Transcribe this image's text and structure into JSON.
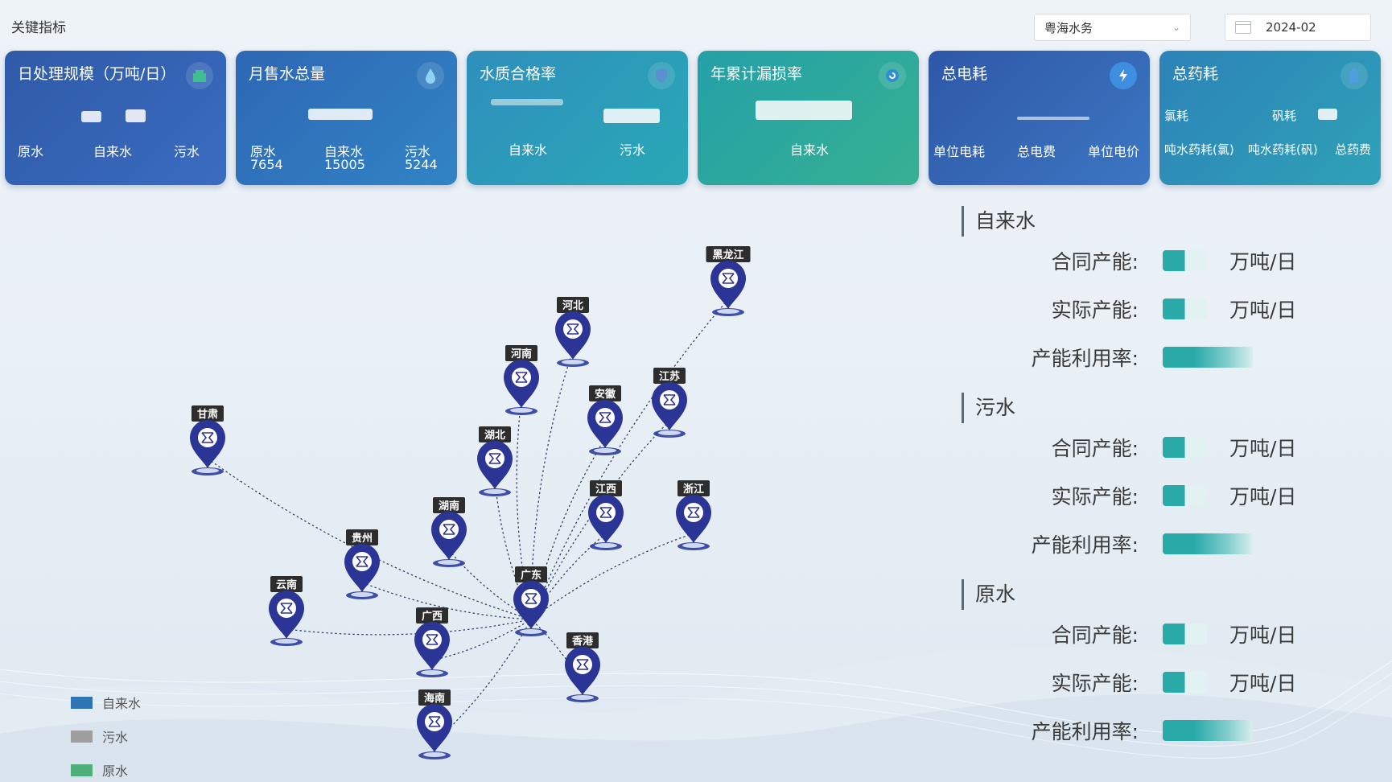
{
  "header": {
    "title": "关键指标",
    "org_select": "粤海水务",
    "date": "2024-02"
  },
  "cards": {
    "daily_scale": {
      "title": "日处理规模（万吨/日）",
      "icon": "building-icon",
      "labels": [
        "原水",
        "自来水",
        "污水"
      ]
    },
    "monthly_sales": {
      "title": "月售水总量",
      "icon": "water-drop-icon",
      "labels": [
        "原水",
        "自来水",
        "污水"
      ],
      "values": [
        "7654",
        "15005",
        "5244"
      ]
    },
    "water_quality": {
      "title": "水质合格率",
      "icon": "shield-icon",
      "labels": [
        "自来水",
        "污水"
      ]
    },
    "leak_rate": {
      "title": "年累计漏损率",
      "icon": "refresh-icon",
      "labels": [
        "自来水"
      ]
    },
    "power": {
      "title": "总电耗",
      "icon": "lightning-drop-icon",
      "labels": [
        "单位电耗",
        "总电费",
        "单位电价"
      ]
    },
    "chemicals": {
      "title": "总药耗",
      "icon": "bottle-icon",
      "top_labels": [
        "氯耗",
        "矾耗"
      ],
      "labels": [
        "吨水药耗(氯)",
        "吨水药耗(矾)",
        "总药费"
      ]
    }
  },
  "map": {
    "provinces": [
      "黑龙江",
      "河北",
      "河南",
      "江苏",
      "安徽",
      "甘肃",
      "湖北",
      "江西",
      "浙江",
      "湖南",
      "贵州",
      "广东",
      "云南",
      "广西",
      "香港",
      "海南"
    ],
    "hub": "广东"
  },
  "legend": [
    {
      "label": "自来水",
      "color": "#2f74b5"
    },
    {
      "label": "污水",
      "color": "#9e9e9e"
    },
    {
      "label": "原水",
      "color": "#4fae7a"
    }
  ],
  "right_panel": {
    "sections": [
      {
        "title": "自来水",
        "rows": [
          {
            "label": "合同产能:",
            "unit": "万吨/日"
          },
          {
            "label": "实际产能:",
            "unit": "万吨/日"
          },
          {
            "label": "产能利用率:",
            "unit": ""
          }
        ]
      },
      {
        "title": "污水",
        "rows": [
          {
            "label": "合同产能:",
            "unit": "万吨/日"
          },
          {
            "label": "实际产能:",
            "unit": "万吨/日"
          },
          {
            "label": "产能利用率:",
            "unit": ""
          }
        ]
      },
      {
        "title": "原水",
        "rows": [
          {
            "label": "合同产能:",
            "unit": "万吨/日"
          },
          {
            "label": "实际产能:",
            "unit": "万吨/日"
          },
          {
            "label": "产能利用率:",
            "unit": ""
          }
        ]
      }
    ]
  }
}
